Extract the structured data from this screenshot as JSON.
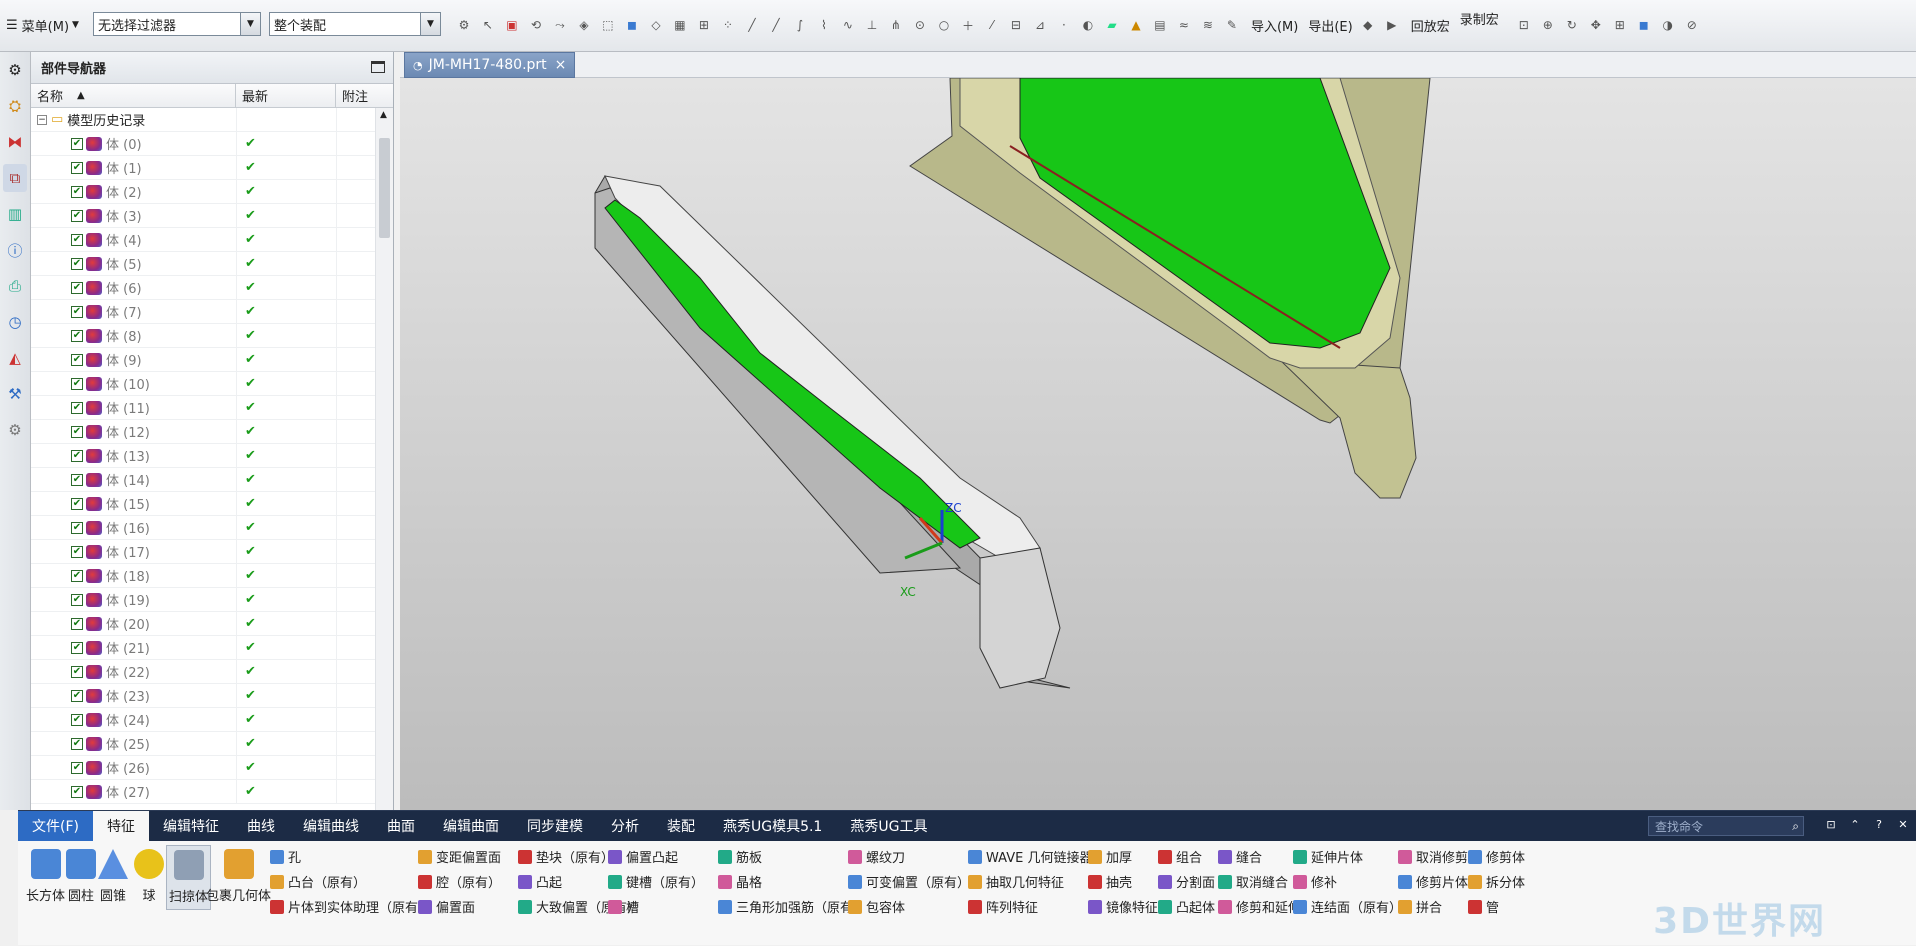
{
  "toolbar": {
    "menu_label": "菜单(M)",
    "filter_value": "无选择过滤器",
    "assembly_value": "整个装配",
    "import_label": "导入(M)",
    "export_label": "导出(E)",
    "playback_label": "回放宏",
    "record_label": "录制宏"
  },
  "navigator": {
    "title": "部件导航器",
    "col_name": "名称",
    "col_latest": "最新",
    "col_note": "附注",
    "root_label": "模型历史记录",
    "check_glyph": "✔",
    "items": [
      "体 (0)",
      "体 (1)",
      "体 (2)",
      "体 (3)",
      "体 (4)",
      "体 (5)",
      "体 (6)",
      "体 (7)",
      "体 (8)",
      "体 (9)",
      "体 (10)",
      "体 (11)",
      "体 (12)",
      "体 (13)",
      "体 (14)",
      "体 (15)",
      "体 (16)",
      "体 (17)",
      "体 (18)",
      "体 (19)",
      "体 (20)",
      "体 (21)",
      "体 (22)",
      "体 (23)",
      "体 (24)",
      "体 (25)",
      "体 (26)",
      "体 (27)"
    ]
  },
  "document_tab": {
    "name": "JM-MH17-480.prt",
    "close": "×"
  },
  "viewport": {
    "axis_z": "ZC",
    "axis_x": "XC"
  },
  "ribbon": {
    "tabs": [
      "文件(F)",
      "特征",
      "编辑特征",
      "曲线",
      "编辑曲线",
      "曲面",
      "编辑曲面",
      "同步建模",
      "分析",
      "装配",
      "燕秀UG模具5.1",
      "燕秀UG工具"
    ],
    "search_placeholder": "查找命令",
    "big_buttons": [
      "长方体",
      "圆柱",
      "圆锥",
      "球",
      "扫掠体",
      "包裹几何体"
    ],
    "columns": [
      [
        "孔",
        "凸台（原有）",
        "片体到实体助理（原有）"
      ],
      [
        "变距偏置面",
        "腔（原有）",
        "偏置面"
      ],
      [
        "垫块（原有）",
        "凸起",
        "大致偏置（原有）"
      ],
      [
        "偏置凸起",
        "键槽（原有）",
        "槽"
      ],
      [
        "筋板",
        "晶格",
        "三角形加强筋（原有）"
      ],
      [
        "螺纹刀",
        "可变偏置（原有）",
        "包容体"
      ],
      [
        "WAVE 几何链接器",
        "抽取几何特征",
        "阵列特征"
      ],
      [
        "加厚",
        "抽壳",
        "镜像特征"
      ],
      [
        "组合",
        "分割面",
        "凸起体"
      ],
      [
        "缝合",
        "取消缝合",
        "修剪和延伸"
      ],
      [
        "延伸片体",
        "修补",
        "连结面（原有）"
      ],
      [
        "取消修剪",
        "修剪片体",
        "拼合"
      ],
      [
        "修剪体",
        "拆分体",
        "管"
      ]
    ]
  },
  "colors": {
    "ribbon_bg": "#1c2b45",
    "file_tab": "#2d6bc4",
    "check": "#1a9c1a",
    "green_face": "#17c617",
    "tan_body": "#b9b98a"
  }
}
